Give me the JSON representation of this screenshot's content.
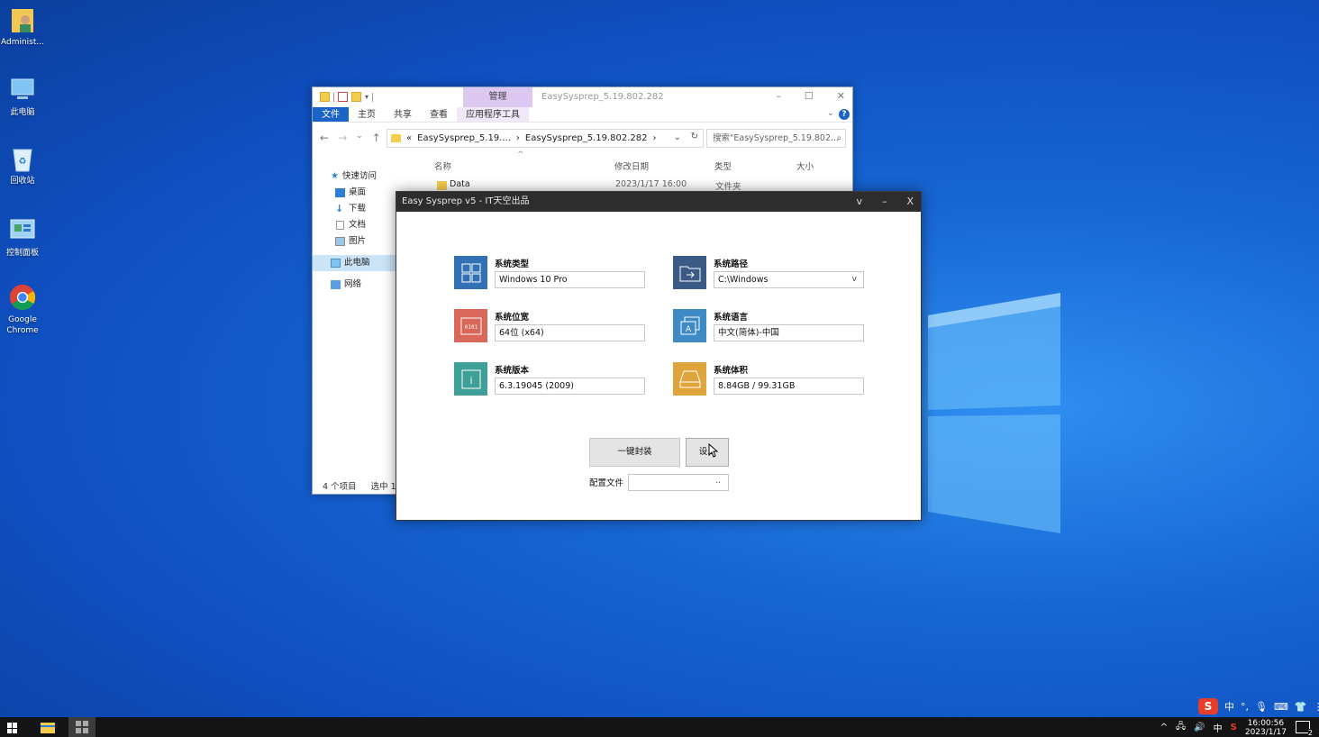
{
  "desktop": {
    "icons": [
      {
        "label": "Administ..."
      },
      {
        "label": "此电脑"
      },
      {
        "label": "回收站"
      },
      {
        "label": "控制面板"
      },
      {
        "label": "Google Chrome"
      }
    ]
  },
  "explorer": {
    "title": "EasySysprep_5.19.802.282",
    "manage_tab": "管理",
    "ribbon": {
      "file": "文件",
      "home": "主页",
      "share": "共享",
      "view": "查看",
      "app_tools": "应用程序工具"
    },
    "breadcrumb": {
      "prefix": "«",
      "part1": "EasySysprep_5.19....",
      "part2": "EasySysprep_5.19.802.282"
    },
    "search_placeholder": "搜索\"EasySysprep_5.19.802...",
    "nav": {
      "quick_access": "快速访问",
      "desktop": "桌面",
      "downloads": "下载",
      "documents": "文档",
      "pictures": "图片",
      "this_pc": "此电脑",
      "network": "网络"
    },
    "columns": {
      "name": "名称",
      "modified": "修改日期",
      "type": "类型",
      "size": "大小"
    },
    "rows": [
      {
        "name": "Data",
        "modified": "2023/1/17 16:00",
        "type": "文件夹"
      }
    ],
    "status": {
      "count": "4 个项目",
      "selected": "选中 1"
    }
  },
  "sysprep": {
    "title": "Easy Sysprep v5 - IT天空出品",
    "controls": {
      "menu": "v",
      "minimize": "–",
      "close": "X"
    },
    "fields": {
      "os_type": {
        "label": "系统类型",
        "value": "Windows 10 Pro"
      },
      "os_path": {
        "label": "系统路径",
        "value": "C:\\Windows"
      },
      "os_bits": {
        "label": "系统位宽",
        "value": "64位 (x64)"
      },
      "os_lang": {
        "label": "系统语言",
        "value": "中文(简体)-中国"
      },
      "os_ver": {
        "label": "系统版本",
        "value": "6.3.19045 (2009)"
      },
      "os_size": {
        "label": "系统体积",
        "value": "8.84GB / 99.31GB"
      }
    },
    "seal_button": "一键封装",
    "settings_button": "设...",
    "config_label": "配置文件",
    "config_browse": ".."
  },
  "taskbar": {
    "ime": "中",
    "time": "16:00:56",
    "date": "2023/1/17"
  },
  "ime_bar": {
    "logo": "S",
    "mode": "中"
  },
  "colors": {
    "tile_blue": "#3171b4",
    "tile_navy": "#3b5a86",
    "tile_red": "#d9675a",
    "tile_lightblue": "#3e8ac4",
    "tile_teal": "#3e9f98",
    "tile_orange": "#e0a43c"
  }
}
